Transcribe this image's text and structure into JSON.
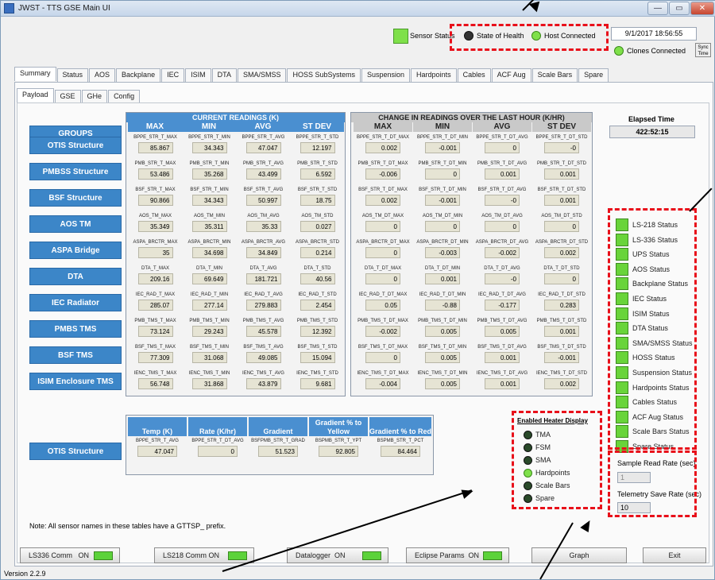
{
  "window": {
    "title": "JWST - TTS GSE Main UI",
    "min_label": "—",
    "max_label": "▭",
    "close_label": "✕"
  },
  "header": {
    "sensor_status": "Sensor Status",
    "state_of_health": "State of Health",
    "host_connected": "Host Connected",
    "datetime": "9/1/2017 18:56:55",
    "clones_connected": "Clones Connected",
    "sync_time": "Sync Time"
  },
  "main_tabs": [
    "Summary",
    "Status",
    "AOS",
    "Backplane",
    "IEC",
    "ISIM",
    "DTA",
    "SMA/SMSS",
    "HOSS SubSystems",
    "Suspension",
    "Hardpoints",
    "Cables",
    "ACF Aug",
    "Scale Bars",
    "Spare"
  ],
  "sub_tabs": [
    "Payload",
    "GSE",
    "GHe",
    "Config"
  ],
  "current": {
    "title": "CURRENT READINGS (K)",
    "cols": [
      "MAX",
      "MIN",
      "AVG",
      "ST DEV"
    ]
  },
  "change": {
    "title": "CHANGE IN READINGS OVER THE LAST HOUR (K/HR)",
    "cols": [
      "MAX",
      "MIN",
      "AVG",
      "ST DEV"
    ]
  },
  "groups_header": "GROUPS",
  "groups": [
    {
      "name": "OTIS Structure",
      "cur_names": [
        "BPPE_STR_T_MAX",
        "BPPE_STR_T_MIN",
        "BPPE_STR_T_AVG",
        "BPPE_STR_T_STD"
      ],
      "cur_vals": [
        "85.867",
        "34.343",
        "47.047",
        "12.197"
      ],
      "chg_names": [
        "BPPE_STR_T_DT_MAX",
        "BPPE_STR_T_DT_MIN",
        "BPPE_STR_T_DT_AVG",
        "BPPE_STR_T_DT_STD"
      ],
      "chg_vals": [
        "0.002",
        "-0.001",
        "0",
        "-0"
      ]
    },
    {
      "name": "PMBSS Structure",
      "cur_names": [
        "PMB_STR_T_MAX",
        "PMB_STR_T_MIN",
        "PMB_STR_T_AVG",
        "PMB_STR_T_STD"
      ],
      "cur_vals": [
        "53.486",
        "35.268",
        "43.499",
        "6.592"
      ],
      "chg_names": [
        "PMB_STR_T_DT_MAX",
        "PMB_STR_T_DT_MIN",
        "PMB_STR_T_DT_AVG",
        "PMB_STR_T_DT_STD"
      ],
      "chg_vals": [
        "-0.006",
        "0",
        "0.001",
        "0.001"
      ]
    },
    {
      "name": "BSF Structure",
      "cur_names": [
        "BSF_STR_T_MAX",
        "BSF_STR_T_MIN",
        "BSF_STR_T_AVG",
        "BSF_STR_T_STD"
      ],
      "cur_vals": [
        "90.866",
        "34.343",
        "50.997",
        "18.75"
      ],
      "chg_names": [
        "BSF_STR_T_DT_MAX",
        "BSF_STR_T_DT_MIN",
        "BSF_STR_T_DT_AVG",
        "BSF_STR_T_DT_STD"
      ],
      "chg_vals": [
        "0.002",
        "-0.001",
        "-0",
        "0.001"
      ]
    },
    {
      "name": "AOS TM",
      "cur_names": [
        "AOS_TM_MAX",
        "AOS_TM_MIN",
        "AOS_TM_AVG",
        "AOS_TM_STD"
      ],
      "cur_vals": [
        "35.349",
        "35.311",
        "35.33",
        "0.027"
      ],
      "chg_names": [
        "AOS_TM_DT_MAX",
        "AOS_TM_DT_MIN",
        "AOS_TM_DT_AVG",
        "AOS_TM_DT_STD"
      ],
      "chg_vals": [
        "0",
        "0",
        "0",
        "0"
      ]
    },
    {
      "name": "ASPA Bridge",
      "cur_names": [
        "ASPA_BRCTR_MAX",
        "ASPA_BRCTR_MIN",
        "ASPA_BRCTR_AVG",
        "ASPA_BRCTR_STD"
      ],
      "cur_vals": [
        "35",
        "34.698",
        "34.849",
        "0.214"
      ],
      "chg_names": [
        "ASPA_BRCTR_DT_MAX",
        "ASPA_BRCTR_DT_MIN",
        "ASPA_BRCTR_DT_AVG",
        "ASPA_BRCTR_DT_STD"
      ],
      "chg_vals": [
        "0",
        "-0.003",
        "-0.002",
        "0.002"
      ]
    },
    {
      "name": "DTA",
      "cur_names": [
        "DTA_T_MAX",
        "DTA_T_MIN",
        "DTA_T_AVG",
        "DTA_T_STD"
      ],
      "cur_vals": [
        "209.16",
        "69.649",
        "181.721",
        "40.56"
      ],
      "chg_names": [
        "DTA_T_DT_MAX",
        "DTA_T_DT_MIN",
        "DTA_T_DT_AVG",
        "DTA_T_DT_STD"
      ],
      "chg_vals": [
        "0",
        "0.001",
        "-0",
        "0"
      ]
    },
    {
      "name": "IEC Radiator",
      "cur_names": [
        "IEC_RAD_T_MAX",
        "IEC_RAD_T_MIN",
        "IEC_RAD_T_AVG",
        "IEC_RAD_T_STD"
      ],
      "cur_vals": [
        "285.07",
        "277.14",
        "279.883",
        "2.454"
      ],
      "chg_names": [
        "IEC_RAD_T_DT_MAX",
        "IEC_RAD_T_DT_MIN",
        "IEC_RAD_T_DT_AVG",
        "IEC_RAD_T_DT_STD"
      ],
      "chg_vals": [
        "0.05",
        "-0.88",
        "-0.177",
        "0.283"
      ]
    },
    {
      "name": "PMBS TMS",
      "cur_names": [
        "PMB_TMS_T_MAX",
        "PMB_TMS_T_MIN",
        "PMB_TMS_T_AVG",
        "PMB_TMS_T_STD"
      ],
      "cur_vals": [
        "73.124",
        "29.243",
        "45.578",
        "12.392"
      ],
      "chg_names": [
        "PMB_TMS_T_DT_MAX",
        "PMB_TMS_T_DT_MIN",
        "PMB_TMS_T_DT_AVG",
        "PMB_TMS_T_DT_STD"
      ],
      "chg_vals": [
        "-0.002",
        "0.005",
        "0.005",
        "0.001"
      ]
    },
    {
      "name": "BSF TMS",
      "cur_names": [
        "BSF_TMS_T_MAX",
        "BSF_TMS_T_MIN",
        "BSF_TMS_T_AVG",
        "BSF_TMS_T_STD"
      ],
      "cur_vals": [
        "77.309",
        "31.068",
        "49.085",
        "15.094"
      ],
      "chg_names": [
        "BSF_TMS_T_DT_MAX",
        "BSF_TMS_T_DT_MIN",
        "BSF_TMS_T_DT_AVG",
        "BSF_TMS_T_DT_STD"
      ],
      "chg_vals": [
        "0",
        "0.005",
        "0.001",
        "-0.001"
      ]
    },
    {
      "name": "ISIM Enclosure TMS",
      "cur_names": [
        "IENC_TMS_T_MAX",
        "IENC_TMS_T_MIN",
        "IENC_TMS_T_AVG",
        "IENC_TMS_T_STD"
      ],
      "cur_vals": [
        "56.748",
        "31.868",
        "43.879",
        "9.681"
      ],
      "chg_names": [
        "IENC_TMS_T_DT_MAX",
        "IENC_TMS_T_DT_MIN",
        "IENC_TMS_T_DT_AVG",
        "IENC_TMS_T_DT_STD"
      ],
      "chg_vals": [
        "-0.004",
        "0.005",
        "0.001",
        "0.002"
      ]
    }
  ],
  "elapsed": {
    "label": "Elapsed Time",
    "value": "422:52:15"
  },
  "status_items": [
    "LS-218 Status",
    "LS-336 Status",
    "UPS Status",
    "AOS Status",
    "Backplane Status",
    "IEC Status",
    "ISIM Status",
    "DTA Status",
    "SMA/SMSS Status",
    "HOSS Status",
    "Suspension Status",
    "Hardpoints Status",
    "Cables Status",
    "ACF Aug Status",
    "Scale Bars Status",
    "Spare Status"
  ],
  "otis": {
    "label": "OTIS Structure",
    "headers": [
      "Temp (K)",
      "Rate (K/hr)",
      "Gradient",
      "Gradient % to Yellow",
      "Gradient % to Red"
    ],
    "names": [
      "BPPE_STR_T_AVG",
      "BPPE_STR_T_DT_AVG",
      "BSFPMB_STR_T_GRAD",
      "BSPMB_STR_T_YPT",
      "BSPMB_STR_T_PCT"
    ],
    "values": [
      "47.047",
      "0",
      "51.523",
      "92.805",
      "84.464"
    ]
  },
  "heater": {
    "title": "Enabled Heater Display",
    "items": [
      {
        "label": "TMA",
        "on": false
      },
      {
        "label": "FSM",
        "on": false
      },
      {
        "label": "SMA",
        "on": false
      },
      {
        "label": "Hardpoints",
        "on": true
      },
      {
        "label": "Scale Bars",
        "on": false
      },
      {
        "label": "Spare",
        "on": false
      }
    ]
  },
  "rates": {
    "sample_label": "Sample Read Rate (sec)",
    "sample_value": "1",
    "telemetry_label": "Telemetry Save Rate (sec)",
    "telemetry_value": "10"
  },
  "note": "Note: All sensor names in these tables have a GTTSP_ prefix.",
  "bottom": {
    "ls336": "LS336 Comm",
    "ls336_state": "ON",
    "ls218": "LS218 Comm",
    "ls218_state": "ON",
    "datalogger": "Datalogger",
    "datalogger_state": "ON",
    "eclipse": "Eclipse Params",
    "eclipse_state": "ON",
    "graph": "Graph",
    "exit": "Exit"
  },
  "version": "Version 2.2.9",
  "colors": {
    "accent_blue": "#4a8fd0",
    "led_green": "#7fe04a",
    "annotation_red": "#e8101a"
  }
}
